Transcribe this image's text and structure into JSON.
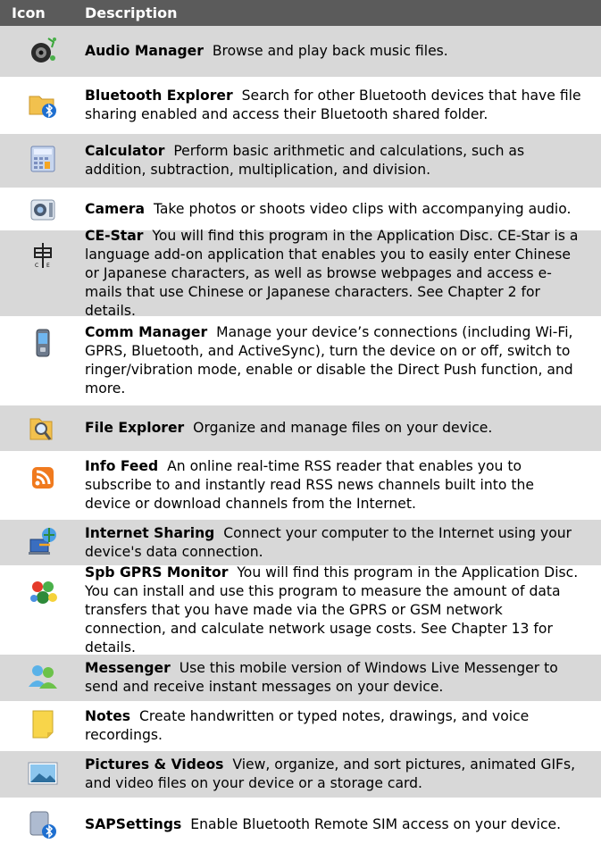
{
  "header": {
    "col_icon": "Icon",
    "col_description": "Description"
  },
  "rows": [
    {
      "name": "Audio Manager",
      "desc": "Browse and play back music files.",
      "icon": "audio-manager-icon"
    },
    {
      "name": "Bluetooth Explorer",
      "desc": "Search for other Bluetooth devices that have file sharing enabled and access their Bluetooth shared folder.",
      "icon": "bluetooth-explorer-icon"
    },
    {
      "name": "Calculator",
      "desc": "Perform basic arithmetic and calculations, such as addition, subtraction, multiplication, and division.",
      "icon": "calculator-icon"
    },
    {
      "name": "Camera",
      "desc": "Take photos or shoots video clips with accompanying audio.",
      "icon": "camera-icon"
    },
    {
      "name": "CE-Star",
      "desc": "You will find this program in the Application Disc.  CE-Star is a language add-on application that enables you to easily enter Chinese or Japanese characters, as well as browse webpages and access e-mails that use Chinese or Japanese characters.  See Chapter 2 for details.",
      "icon": "ce-star-icon"
    },
    {
      "name": "Comm Manager",
      "desc": "Manage your device’s connections (including Wi-Fi, GPRS, Bluetooth, and ActiveSync), turn the device on or off, switch to ringer/vibration mode, enable or disable the Direct Push function, and more.",
      "icon": "comm-manager-icon"
    },
    {
      "name": "File Explorer",
      "desc": "Organize and manage files on your device.",
      "icon": "file-explorer-icon"
    },
    {
      "name": "Info Feed",
      "desc": "An online real-time RSS reader that enables you to subscribe to and instantly read RSS news channels built into the device or download channels from the Internet.",
      "icon": "rss-icon"
    },
    {
      "name": "Internet Sharing",
      "desc": "Connect your computer to the Internet using your device's data connection.",
      "icon": "internet-sharing-icon"
    },
    {
      "name": "Spb GPRS Monitor",
      "desc": "You will find this program in the Application Disc. You can install and use this program to measure the amount of data transfers that you have made via the GPRS or GSM network connection, and calculate network usage costs. See Chapter 13 for details.",
      "icon": "gprs-monitor-icon"
    },
    {
      "name": "Messenger",
      "desc": "Use this mobile version of Windows Live Messenger to send and receive instant messages on your device.",
      "icon": "messenger-icon"
    },
    {
      "name": "Notes",
      "desc": "Create handwritten or typed notes, drawings, and voice recordings.",
      "icon": "notes-icon"
    },
    {
      "name": "Pictures & Videos",
      "desc": "View, organize, and sort pictures, animated GIFs, and video files on your device or a storage card.",
      "icon": "pictures-videos-icon"
    },
    {
      "name": "SAPSettings",
      "desc": "Enable Bluetooth Remote SIM access on your device.",
      "icon": "sap-settings-icon"
    }
  ]
}
